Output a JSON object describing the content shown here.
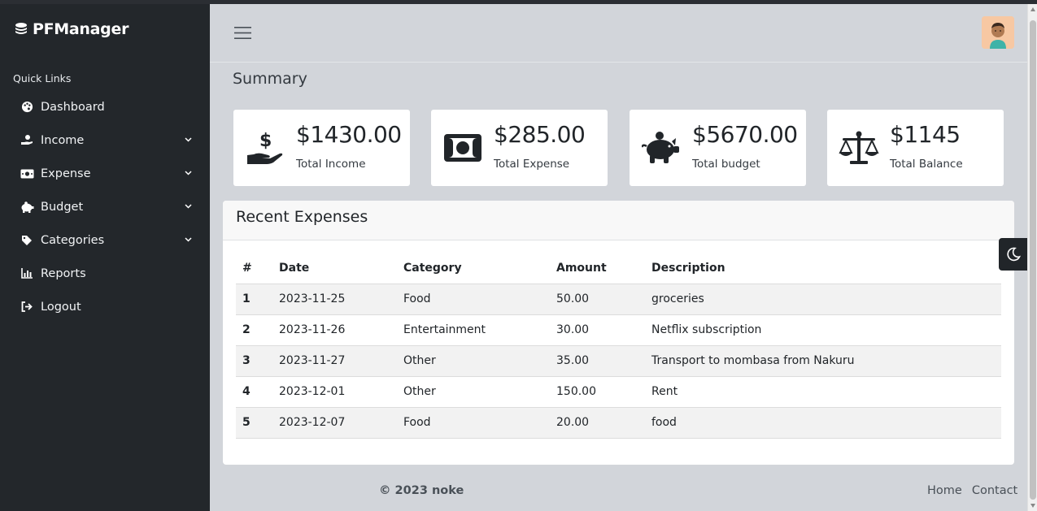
{
  "brand": {
    "name": "PFManager"
  },
  "sidebar": {
    "section_label": "Quick Links",
    "items": [
      {
        "label": "Dashboard",
        "icon": "palette-icon",
        "has_children": false
      },
      {
        "label": "Income",
        "icon": "hand-coin-icon",
        "has_children": true
      },
      {
        "label": "Expense",
        "icon": "money-bill-icon",
        "has_children": true
      },
      {
        "label": "Budget",
        "icon": "piggy-bank-icon",
        "has_children": true
      },
      {
        "label": "Categories",
        "icon": "tag-icon",
        "has_children": true
      },
      {
        "label": "Reports",
        "icon": "chart-bar-icon",
        "has_children": false
      },
      {
        "label": "Logout",
        "icon": "sign-out-icon",
        "has_children": false
      }
    ]
  },
  "summary": {
    "title": "Summary",
    "cards": [
      {
        "value": "$1430.00",
        "label": "Total Income",
        "icon": "hand-dollar-icon"
      },
      {
        "value": "$285.00",
        "label": "Total Expense",
        "icon": "money-bill-icon"
      },
      {
        "value": "$5670.00",
        "label": "Total budget",
        "icon": "piggy-bank-icon"
      },
      {
        "value": "$1145",
        "label": "Total Balance",
        "icon": "scale-balanced-icon"
      }
    ]
  },
  "recent_expenses": {
    "title": "Recent Expenses",
    "columns": [
      "#",
      "Date",
      "Category",
      "Amount",
      "Description"
    ],
    "rows": [
      [
        "1",
        "2023-11-25",
        "Food",
        "50.00",
        "groceries"
      ],
      [
        "2",
        "2023-11-26",
        "Entertainment",
        "30.00",
        "Netflix subscription"
      ],
      [
        "3",
        "2023-11-27",
        "Other",
        "35.00",
        "Transport to mombasa from Nakuru"
      ],
      [
        "4",
        "2023-12-01",
        "Other",
        "150.00",
        "Rent"
      ],
      [
        "5",
        "2023-12-07",
        "Food",
        "20.00",
        "food"
      ]
    ]
  },
  "footer": {
    "copyright": "© 2023 noke",
    "links": [
      "Home",
      "Contact"
    ]
  },
  "colors": {
    "sidebar": "#23272b",
    "page": "#d2d5da",
    "card": "#ffffff"
  }
}
